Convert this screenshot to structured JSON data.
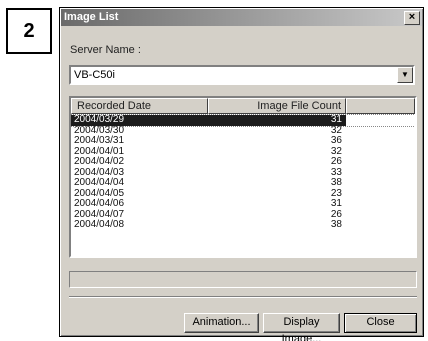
{
  "step_number": "2",
  "dialog": {
    "title": "Image List",
    "close_glyph": "×"
  },
  "server": {
    "label": "Server Name :",
    "value": "VB-C50i",
    "dropdown_glyph": "▼"
  },
  "list": {
    "columns": [
      "Recorded Date",
      "Image File Count",
      ""
    ],
    "rows": [
      {
        "date": "2004/03/29",
        "count": "31"
      },
      {
        "date": "2004/03/30",
        "count": "32"
      },
      {
        "date": "2004/03/31",
        "count": "36"
      },
      {
        "date": "2004/04/01",
        "count": "32"
      },
      {
        "date": "2004/04/02",
        "count": "26"
      },
      {
        "date": "2004/04/03",
        "count": "33"
      },
      {
        "date": "2004/04/04",
        "count": "38"
      },
      {
        "date": "2004/04/05",
        "count": "23"
      },
      {
        "date": "2004/04/06",
        "count": "31"
      },
      {
        "date": "2004/04/07",
        "count": "26"
      },
      {
        "date": "2004/04/08",
        "count": "38"
      }
    ],
    "selected_index": 0
  },
  "progress": {
    "value": 0
  },
  "buttons": {
    "animation": "Animation...",
    "display": "Display Image...",
    "close": "Close"
  }
}
